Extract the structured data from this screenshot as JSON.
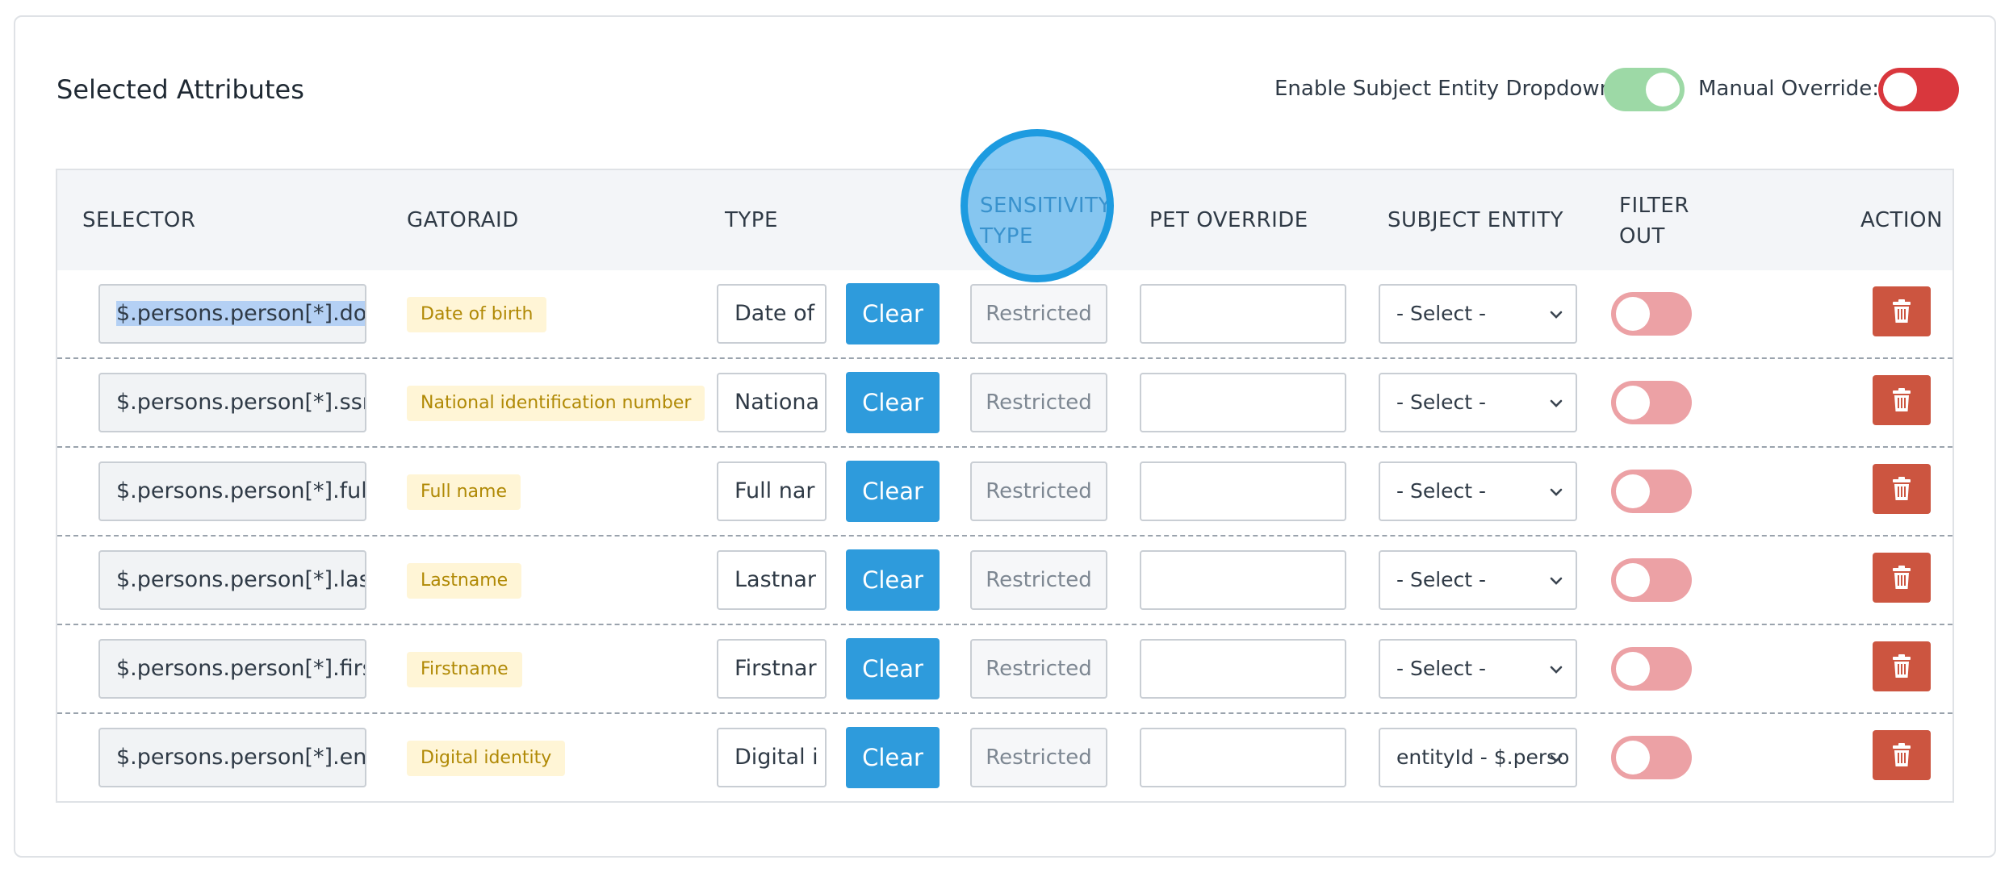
{
  "header": {
    "title": "Selected Attributes",
    "enable_dropdown_label": "Enable Subject Entity Dropdown",
    "manual_override_label": "Manual Override:"
  },
  "colors": {
    "enable_toggle": "#9dd9a6",
    "manual_override_toggle": "#d9373d",
    "clear_button": "#2e9bdc",
    "delete_button": "#cc5540",
    "badge_bg": "#fff5d6",
    "badge_text": "#b08905"
  },
  "table": {
    "columns": {
      "selector": "SELECTOR",
      "gatoraid": "GATORAID",
      "type": "TYPE",
      "sensitivity_line1": "SENSITIVITY",
      "sensitivity_line2": "TYPE",
      "pet_override": "PET OVERRIDE",
      "subject_entity": "SUBJECT ENTITY",
      "filter_line1": "FILTER",
      "filter_line2": "OUT",
      "action": "ACTION"
    },
    "clear_label": "Clear",
    "restricted_placeholder": "Restricted",
    "rows": [
      {
        "selector": "$.persons.person[*].dob",
        "gatoraid": "Date of birth",
        "type": "Date of",
        "subject_entity": "- Select -"
      },
      {
        "selector": "$.persons.person[*].ssn",
        "gatoraid": "National identification number",
        "type": "Nationa",
        "subject_entity": "- Select -"
      },
      {
        "selector": "$.persons.person[*].fullN",
        "gatoraid": "Full name",
        "type": "Full nar",
        "subject_entity": "- Select -"
      },
      {
        "selector": "$.persons.person[*].last",
        "gatoraid": "Lastname",
        "type": "Lastnar",
        "subject_entity": "- Select -"
      },
      {
        "selector": "$.persons.person[*].first",
        "gatoraid": "Firstname",
        "type": "Firstnar",
        "subject_entity": "- Select -"
      },
      {
        "selector": "$.persons.person[*].enti",
        "gatoraid": "Digital identity",
        "type": "Digital i",
        "subject_entity": "entityId - $.perso"
      }
    ]
  },
  "icons": {
    "delete": "trash-icon",
    "dropdown": "chevron-down-icon"
  }
}
